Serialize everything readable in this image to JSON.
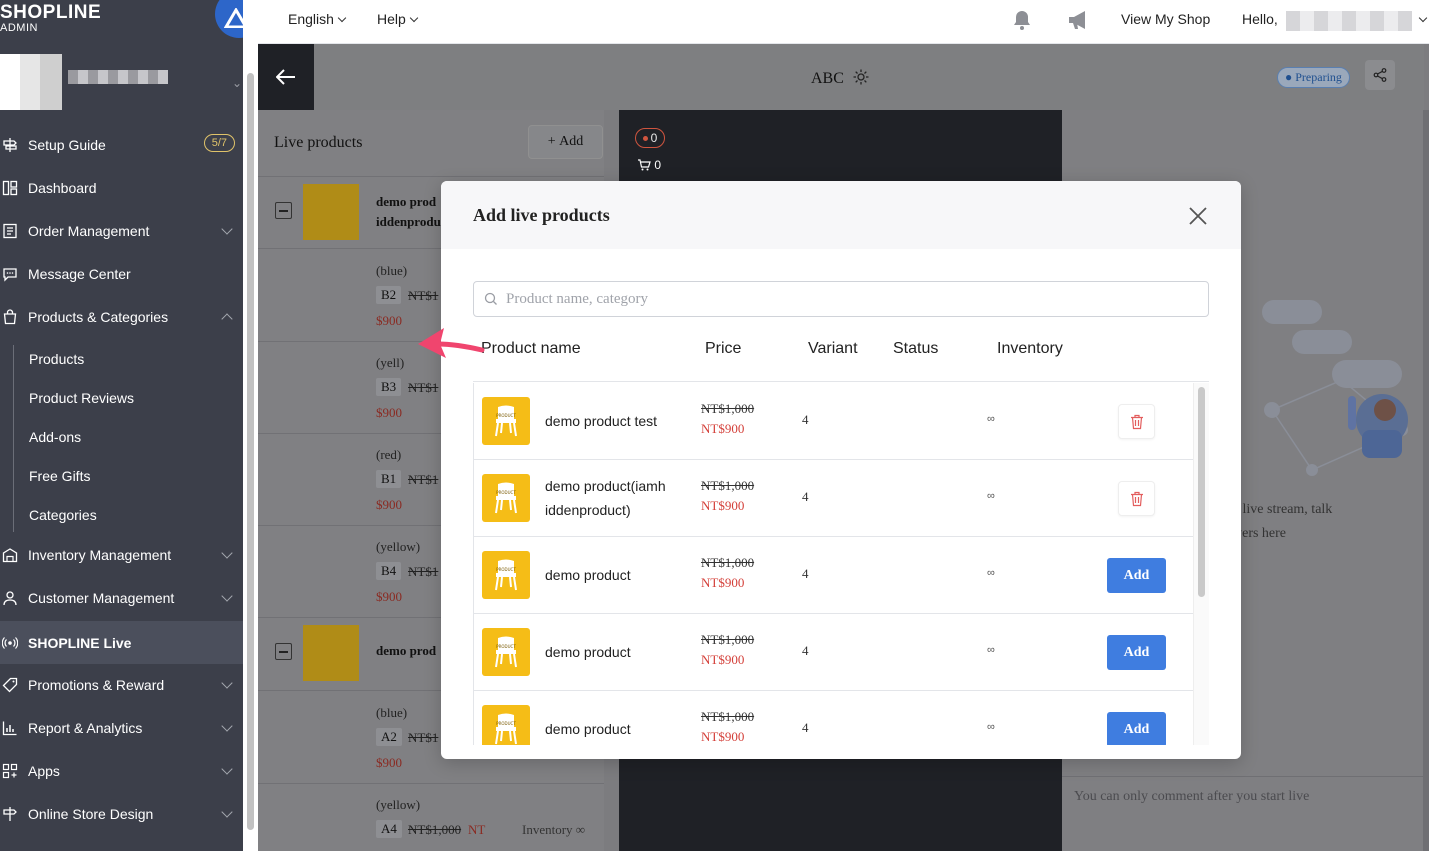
{
  "brand": {
    "logo": "SHOPLINE",
    "sub": "ADMIN"
  },
  "sidebar": {
    "items": [
      {
        "label": "Setup Guide",
        "badge": "5/7",
        "icon": "signpost-icon"
      },
      {
        "label": "Dashboard",
        "icon": "dashboard-icon"
      },
      {
        "label": "Order Management",
        "icon": "order-icon"
      },
      {
        "label": "Message Center",
        "icon": "chat-icon"
      },
      {
        "label": "Products & Categories",
        "icon": "bag-icon"
      },
      {
        "label": "Inventory Management",
        "icon": "warehouse-icon"
      },
      {
        "label": "Customer Management",
        "icon": "user-icon"
      },
      {
        "label": "SHOPLINE Live",
        "icon": "live-icon"
      },
      {
        "label": "Promotions & Reward",
        "icon": "tag-icon"
      },
      {
        "label": "Report & Analytics",
        "icon": "chart-icon"
      },
      {
        "label": "Apps",
        "icon": "apps-icon"
      },
      {
        "label": "Online Store Design",
        "icon": "design-icon"
      }
    ],
    "sub_items": [
      "Products",
      "Product Reviews",
      "Add-ons",
      "Free Gifts",
      "Categories"
    ]
  },
  "topbar": {
    "language": "English",
    "help": "Help",
    "view_shop": "View My Shop",
    "hello": "Hello,"
  },
  "live": {
    "title": "ABC",
    "status": "Preparing",
    "viewers": "0",
    "cart": "0",
    "left_title": "Live products",
    "add_label": "Add",
    "product1_name_line1": "demo prod",
    "product1_name_line2": "iddenprodu",
    "product2_name": "demo prod",
    "variants1": [
      {
        "color": "(blue)",
        "sku": "B2",
        "orig": "NT$1",
        "price": "$900"
      },
      {
        "color": "(yell)",
        "sku": "B3",
        "orig": "NT$1",
        "price": "$900"
      },
      {
        "color": "(red)",
        "sku": "B1",
        "orig": "NT$1",
        "price": "$900"
      },
      {
        "color": "(yellow)",
        "sku": "B4",
        "orig": "NT$1",
        "price": "$900"
      }
    ],
    "variants2": [
      {
        "color": "(blue)",
        "sku": "A2",
        "orig": "NT$1",
        "price": "$900"
      },
      {
        "color": "(yellow)",
        "sku": "A4",
        "orig": "NT$1,000",
        "price": "NT",
        "inventory_label": "Inventory",
        "inventory_value": "∞"
      }
    ],
    "empty_line1": "o live stream, talk",
    "empty_line2": "wers here",
    "comment_placeholder": "You can only comment after you start live"
  },
  "modal": {
    "title": "Add live products",
    "search_placeholder": "Product name, category",
    "columns": {
      "name": "Product name",
      "price": "Price",
      "variant": "Variant",
      "status": "Status",
      "inventory": "Inventory"
    },
    "thumb_label": "PRODUCT",
    "rows": [
      {
        "name": "demo product test",
        "orig": "NT$1,000",
        "sale": "NT$900",
        "variants": "4",
        "inventory": "∞",
        "action": "delete"
      },
      {
        "name": "demo product(iamh iddenproduct)",
        "orig": "NT$1,000",
        "sale": "NT$900",
        "variants": "4",
        "inventory": "∞",
        "action": "delete"
      },
      {
        "name": "demo product",
        "orig": "NT$1,000",
        "sale": "NT$900",
        "variants": "4",
        "inventory": "∞",
        "action": "Add"
      },
      {
        "name": "demo product",
        "orig": "NT$1,000",
        "sale": "NT$900",
        "variants": "4",
        "inventory": "∞",
        "action": "Add"
      },
      {
        "name": "demo product",
        "orig": "NT$1,000",
        "sale": "NT$900",
        "variants": "4",
        "inventory": "∞",
        "action": "Add"
      }
    ]
  },
  "colors": {
    "sidebar_bg": "#3c3f4a",
    "accent": "#3f7de0",
    "sale_red": "#d4403a",
    "annotation_arrow": "#f0456e",
    "product_yellow": "#f5bd17"
  }
}
